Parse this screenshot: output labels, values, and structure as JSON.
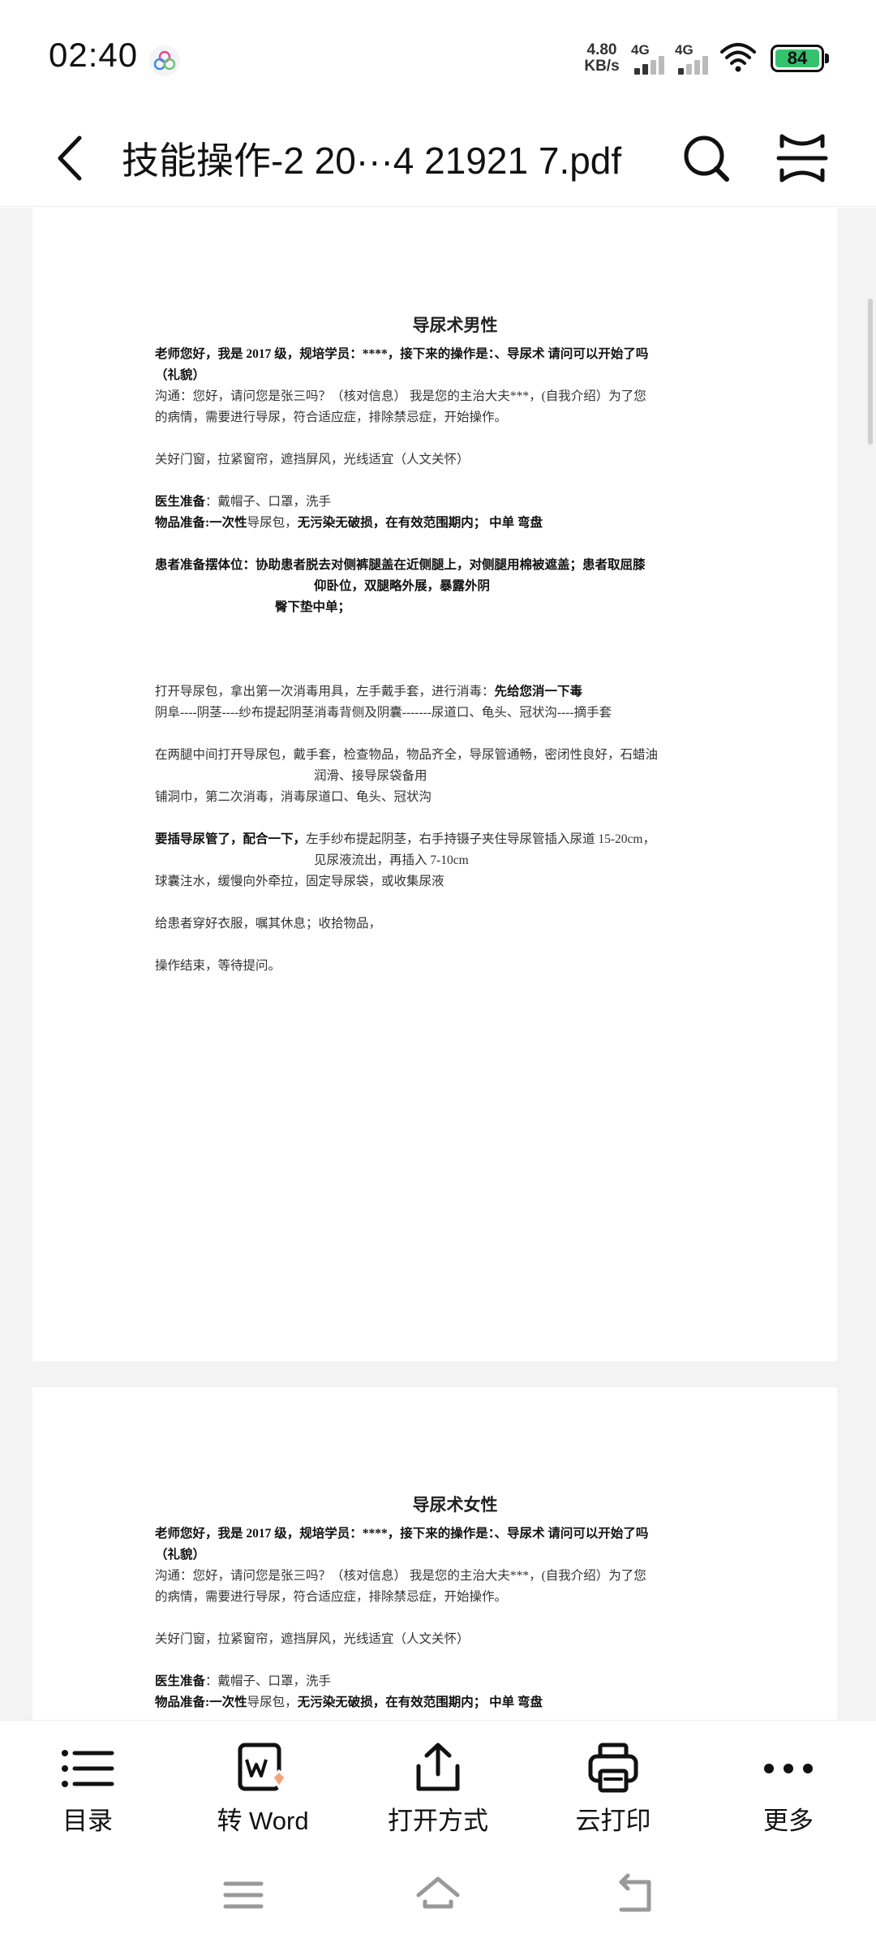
{
  "status_bar": {
    "time": "02:40",
    "net_speed_value": "4.80",
    "net_speed_unit": "KB/s",
    "signal1_label": "4G",
    "signal2_label": "4G",
    "battery": "84",
    "battery_color": "#35c26d"
  },
  "toolbar": {
    "title": "技能操作-2 20···4 21921 7.pdf"
  },
  "document": {
    "page1": {
      "title": "导尿术男性",
      "l1": "老师您好，我是 2017 级，规培学员：****，接下来的操作是：、导尿术 请问可以开始了吗",
      "l2": "（礼貌）",
      "l3": "沟通：您好，请问您是张三吗？（核对信息） 我是您的主治大夫***，(自我介绍）为了您",
      "l4": "的病情，需要进行导尿，符合适应症，排除禁忌症，开始操作。",
      "l5": "关好门窗，拉紧窗帘，遮挡屏风，光线适宜（人文关怀）",
      "l6a": "医生准备",
      "l6b": "：戴帽子、口罩，洗手",
      "l7a": "物品准备:一次性",
      "l7b": "导尿包，",
      "l7c": "无污染无破损，在有效范围期内；    中单    弯盘",
      "l8": "患者准备摆体位：协助患者脱去对侧裤腿盖在近侧腿上，对侧腿用棉被遮盖；患者取屈膝",
      "l9": "仰卧位，双腿略外展，暴露外阴",
      "l10": "臀下垫中单；",
      "l11a": "打开导尿包，拿出第一次消毒用具，左手戴手套，进行消毒：",
      "l11b": "先给您消一下毒",
      "l12": "阴阜----阴茎----纱布提起阴茎消毒背侧及阴囊-------尿道口、龟头、冠状沟----摘手套",
      "l13": "在两腿中间打开导尿包，戴手套，检查物品，物品齐全，导尿管通畅，密闭性良好，石蜡油",
      "l14": "润滑、接导尿袋备用",
      "l15": "铺洞巾，第二次消毒，消毒尿道口、龟头、冠状沟",
      "l16a": "要插导尿管了，配合一下，",
      "l16b": "左手纱布提起阴茎，右手持镊子夹住导尿管插入尿道 15-20cm，",
      "l17": "见尿液流出，再插入 7-10cm",
      "l18": "球囊注水，缓慢向外牵拉，固定导尿袋，或收集尿液",
      "l19": "给患者穿好衣服，嘱其休息；收拾物品，",
      "l20": "操作结束，等待提问。"
    },
    "page2": {
      "title": "导尿术女性",
      "l1": "老师您好，我是 2017 级，规培学员：****，接下来的操作是：、导尿术 请问可以开始了吗",
      "l2": "（礼貌）",
      "l3": "沟通：您好，请问您是张三吗？（核对信息） 我是您的主治大夫***，(自我介绍）为了您",
      "l4": "的病情，需要进行导尿，符合适应症，排除禁忌症，开始操作。",
      "l5": "关好门窗，拉紧窗帘，遮挡屏风，光线适宜（人文关怀）",
      "l6a": "医生准备",
      "l6b": "：戴帽子、口罩，洗手",
      "l7a": "物品准备:一次性",
      "l7b": "导尿包，",
      "l7c": "无污染无破损，在有效范围期内；    中单    弯盘"
    }
  },
  "bottom_bar": {
    "items": [
      {
        "label": "目录",
        "icon": "list-icon"
      },
      {
        "label": "转 Word",
        "icon": "word-convert-icon"
      },
      {
        "label": "打开方式",
        "icon": "share-icon"
      },
      {
        "label": "云打印",
        "icon": "printer-icon"
      },
      {
        "label": "更多",
        "icon": "more-icon"
      }
    ]
  }
}
